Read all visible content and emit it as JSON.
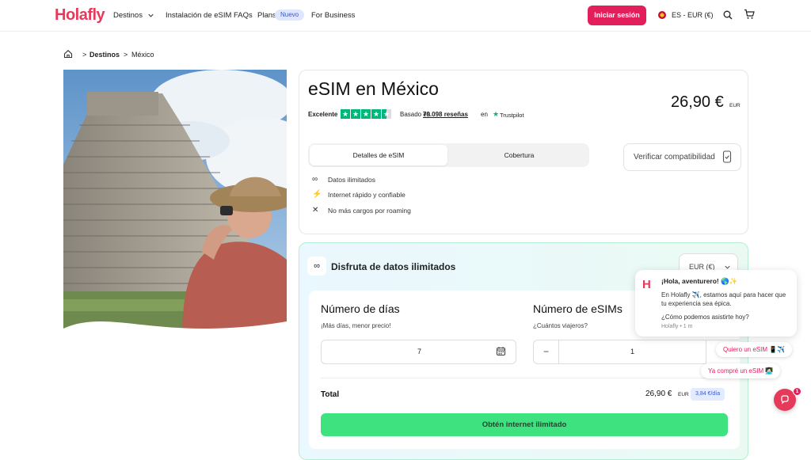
{
  "brand": {
    "logo": "Holafly",
    "accent": "#e21f5b",
    "cta_color": "#3ee37f"
  },
  "nav": {
    "destinos": "Destinos",
    "instalacion": "Instalación de eSIM",
    "faqs": "FAQs",
    "plans": "Plans",
    "nuevo": "Nuevo",
    "business": "For Business",
    "login": "Iniciar sesión",
    "lang": "ES - EUR (€)"
  },
  "breadcrumb": {
    "level1": "Destinos",
    "level2": "México",
    "separator": ">"
  },
  "product": {
    "title": "eSIM en México",
    "rating_label": "Excelente",
    "rating_stars": 4.5,
    "reviews_prefix": "Basado en",
    "reviews_count": "79.098 reseñas",
    "reviews_suffix": "en",
    "trustpilot": "Trustpilot",
    "price": "26,90 €",
    "price_currency": "EUR",
    "tabs": [
      "Detalles de eSIM",
      "Cobertura"
    ],
    "verify": "Verificar compatibilidad",
    "features": [
      "Datos ilimitados",
      "Internet rápido y confiable",
      "No más cargos por roaming"
    ]
  },
  "plan": {
    "title": "Disfruta de datos ilimitados",
    "currency_select": "EUR (€)",
    "days_heading": "Número de días",
    "days_sub": "¡Más días, menor precio!",
    "days_value": "7",
    "esims_heading": "Número de eSIMs",
    "esims_sub": "¿Cuántos viajeros?",
    "esims_value": "1",
    "minus": "−",
    "plus": "+",
    "total_label": "Total",
    "total_value": "26,90 €",
    "total_currency": "EUR",
    "per_day": "3,84 €/día",
    "cta": "Obtén internet ilimitado"
  },
  "chat": {
    "greeting": "¡Hola, aventurero! 🌎✨",
    "message": "En Holafly ✈️, estamos aquí para hacer que tu experiencia sea épica.",
    "question": "¿Cómo podemos asistirte hoy?",
    "meta": "Holafly • 1 m",
    "chip1": "Quiero un eSIM 📱✈️",
    "chip2": "Ya compré un eSIM 👩🏻‍💻",
    "badge": "1"
  }
}
